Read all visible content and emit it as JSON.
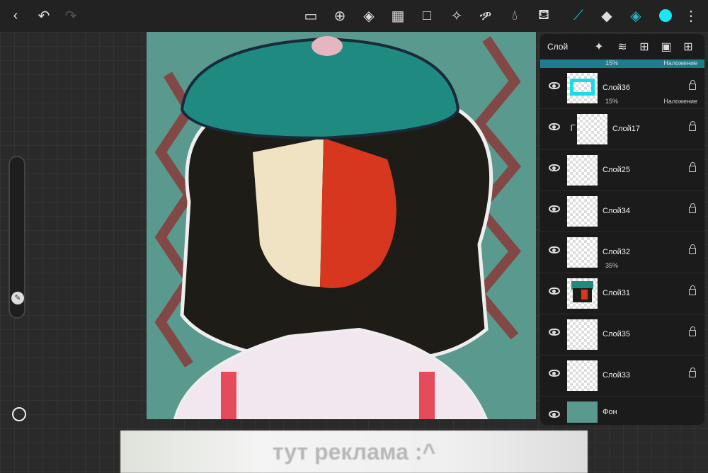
{
  "toolbar": {
    "icons": [
      "back-icon",
      "undo-icon",
      "redo-icon",
      "save-icon",
      "add-icon",
      "fill-icon",
      "grid-icon",
      "transform-icon",
      "magic-wand-icon",
      "lasso-icon",
      "blur-drop-icon",
      "bucket-icon",
      "brush-icon",
      "eraser-icon",
      "layers-icon",
      "color-icon",
      "more-icon"
    ],
    "current_color": "#19e6ef"
  },
  "layers_panel": {
    "title": "Слой",
    "selected": {
      "opacity": "15%",
      "blend": "Наложение"
    },
    "layers": [
      {
        "name": "Слой36",
        "opacity": "15%",
        "blend": "Наложение"
      },
      {
        "name": "Слой17",
        "clipped": true
      },
      {
        "name": "Слой25"
      },
      {
        "name": "Слой34"
      },
      {
        "name": "Слой32",
        "opacity": "35%"
      },
      {
        "name": "Слой31"
      },
      {
        "name": "Слой35"
      },
      {
        "name": "Слой33"
      },
      {
        "name": "Фон"
      }
    ],
    "background_color": "#5a9a8e"
  },
  "ad": {
    "text": "тут реклама :^"
  }
}
